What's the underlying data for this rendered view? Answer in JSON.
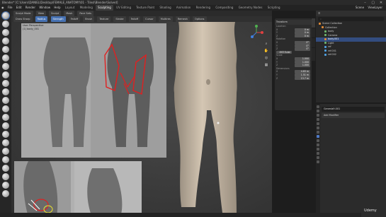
{
  "window": {
    "title": "Blender* [C:\\Users\\DANIEL\\Desktop\\FEMALE_ANATOMY\\01 - Tilesl\\Blender\\Solved]",
    "controls": [
      "–",
      "▢",
      "✕"
    ]
  },
  "menubar": {
    "menus": [
      "File",
      "Edit",
      "Render",
      "Window",
      "Help"
    ],
    "workspaces": [
      "Layout",
      "Modeling",
      "Sculpting",
      "UV Editing",
      "Texture Paint",
      "Shading",
      "Animation",
      "Rendering",
      "Compositing",
      "Geometry Nodes",
      "Scripting"
    ],
    "active_workspace": "Sculpting",
    "scene_label": "Scene",
    "view_layer_label": "ViewLayer"
  },
  "header1": {
    "mode": "Sculpt Mode",
    "items": [
      "View",
      "Sculpt",
      "Mask",
      "Face Sets"
    ]
  },
  "header2": {
    "brush": "Draw Sharp",
    "items": [
      "Radius",
      "Strength",
      "Falloff"
    ],
    "options": [
      "Brush",
      "Texture",
      "Stroke",
      "Falloff",
      "Cursor"
    ],
    "right_items": [
      "Multires",
      "Remesh",
      "Options"
    ]
  },
  "reference": {
    "line1": "User Perspective",
    "line2": "(1) body_001"
  },
  "npanel": {
    "sections": {
      "transform": "Transform",
      "location": "Location",
      "rotation": "Rotation",
      "mode": "XYZ Euler",
      "scale": "Scale",
      "dimensions": "Dimensions"
    },
    "location": [
      {
        "axis": "X",
        "value": "0 m"
      },
      {
        "axis": "Y",
        "value": "0 m"
      },
      {
        "axis": "Z",
        "value": "0 m"
      }
    ],
    "rotation": [
      {
        "axis": "X",
        "value": "0°"
      },
      {
        "axis": "Y",
        "value": "0°"
      },
      {
        "axis": "Z",
        "value": "0°"
      }
    ],
    "scale": [
      {
        "axis": "X",
        "value": "1.000"
      },
      {
        "axis": "Y",
        "value": "1.000"
      },
      {
        "axis": "Z",
        "value": "1.000"
      }
    ],
    "dimensions": [
      {
        "axis": "X",
        "value": "4.83 m"
      },
      {
        "axis": "Y",
        "value": "1.51 m"
      },
      {
        "axis": "Z",
        "value": "13.7 m"
      }
    ],
    "tabs": [
      "Item",
      "Tool",
      "View"
    ]
  },
  "outliner": {
    "search_placeholder": "",
    "items": [
      {
        "label": "Scene Collection",
        "icon": "collection-icon",
        "selected": false,
        "indent": 0
      },
      {
        "label": "Collection",
        "icon": "collection-icon",
        "selected": false,
        "indent": 1
      },
      {
        "label": "body",
        "icon": "mesh-icon",
        "selected": false,
        "indent": 2
      },
      {
        "label": "Camera",
        "icon": "camera-icon",
        "selected": false,
        "indent": 2
      },
      {
        "label": "body.001",
        "icon": "mesh-icon",
        "selected": true,
        "indent": 2
      },
      {
        "label": "Light",
        "icon": "light-icon",
        "selected": false,
        "indent": 2
      },
      {
        "label": "ref",
        "icon": "image-icon",
        "selected": false,
        "indent": 2
      },
      {
        "label": "ref.001",
        "icon": "image-icon",
        "selected": false,
        "indent": 2
      },
      {
        "label": "ref.002",
        "icon": "image-icon",
        "selected": false,
        "indent": 2
      }
    ]
  },
  "properties": {
    "object_name": "Genesis9.001",
    "add_modifier": "Add Modifier"
  },
  "watermark": "Udemy",
  "colors": {
    "accent": "#4772b3",
    "selection": "#334d80",
    "sculpt_stroke": "#e02020",
    "skin": "#c2b3a0"
  }
}
